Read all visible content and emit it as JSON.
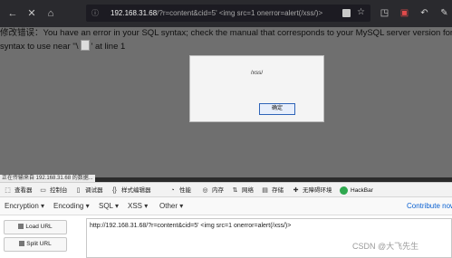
{
  "browser": {
    "url_host": "192.168.31.68",
    "url_path": "/?r=content&cid=5' <img src=1 onerror=alert(/xss/)>",
    "icons": [
      "back-icon",
      "reload-stop-icon",
      "home-icon",
      "site-info-icon",
      "clear-icon",
      "star-icon",
      "extension-icon",
      "reader-icon",
      "undo-icon",
      "share-icon",
      "menu-icon"
    ]
  },
  "page": {
    "error_line1": "修改错误：You have an error in your SQL syntax; check the manual that corresponds to your MySQL server version for the",
    "error_line2_a": "syntax to use near ''\\",
    "error_line2_b": "' at line 1",
    "status": "正在传输来自 192.168.31.68 的数据..."
  },
  "dialog": {
    "message": "/xss/",
    "ok_label": "确定"
  },
  "devtools": {
    "tabs": [
      {
        "label": "查看器",
        "icon": "inspector-icon"
      },
      {
        "label": "控制台",
        "icon": "console-icon"
      },
      {
        "label": "调试器",
        "icon": "debugger-icon"
      },
      {
        "label": "样式编辑器",
        "icon": "style-editor-icon"
      },
      {
        "label": "性能",
        "icon": "performance-icon"
      },
      {
        "label": "内存",
        "icon": "memory-icon"
      },
      {
        "label": "网络",
        "icon": "network-icon"
      },
      {
        "label": "存储",
        "icon": "storage-icon"
      },
      {
        "label": "无障碍环境",
        "icon": "accessibility-icon"
      },
      {
        "label": "HackBar",
        "icon": "hackbar-icon"
      }
    ],
    "active_tab": "HackBar"
  },
  "hackbar": {
    "menu": [
      "Encryption",
      "Encoding",
      "SQL",
      "XSS",
      "Other"
    ],
    "contribute": "Contribute now",
    "load_url": "Load URL",
    "split_url": "Split URL",
    "url_value": "http://192.168.31.68/?r=content&cid=5' <img src=1 onerror=alert(/xss/)>"
  },
  "watermark": "CSDN @大飞先生"
}
